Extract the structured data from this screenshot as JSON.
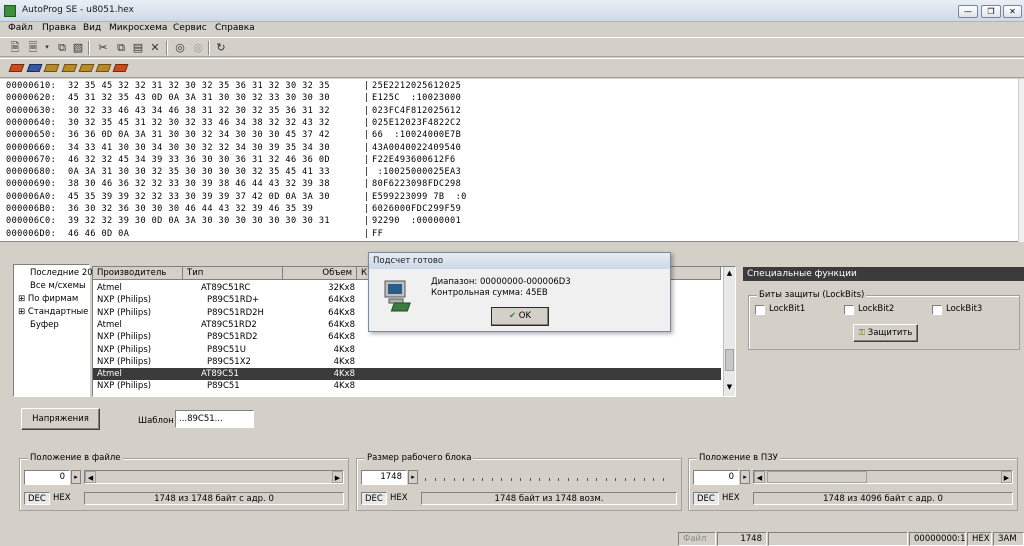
{
  "window": {
    "title": "AutoProg SE - u8051.hex",
    "buttons": [
      "minimize",
      "restore",
      "close"
    ]
  },
  "menubar": [
    "Файл",
    "Правка",
    "Вид",
    "Микросхема",
    "Сервис",
    "Справка"
  ],
  "toolbar1_icons": [
    "open-file-icon",
    "save-file-icon",
    "dropdown-arrow-icon",
    "copy-files-icon",
    "paste-files-icon",
    "cut-icon",
    "copy-icon",
    "paste-icon",
    "delete-icon",
    "find-icon",
    "find-next-icon",
    "refresh-icon"
  ],
  "toolbar2_icons": [
    "chip-read-icon",
    "chip-program-icon",
    "chip-verify-icon",
    "chip-erase-icon",
    "chip-blank-icon",
    "chip-auto-icon"
  ],
  "hex_rows": [
    {
      "addr": "00000610:",
      "bytes": "32 35 45 32 32 31 32 30 32 35 36 31 32 30 32 35",
      "ascii": "25E2212025612025"
    },
    {
      "addr": "00000620:",
      "bytes": "45 31 32 35 43 0D 0A 3A 31 30 30 32 33 30 30 30",
      "ascii": "E125C  :10023000"
    },
    {
      "addr": "00000630:",
      "bytes": "30 32 33 46 43 34 46 38 31 32 30 32 35 36 31 32",
      "ascii": "023FC4F812025612"
    },
    {
      "addr": "00000640:",
      "bytes": "30 32 35 45 31 32 30 32 33 46 34 38 32 32 43 32",
      "ascii": "025E12023F4822C2"
    },
    {
      "addr": "00000650:",
      "bytes": "36 36 0D 0A 3A 31 30 30 32 34 30 30 30 45 37 42",
      "ascii": "66  :10024000E7B"
    },
    {
      "addr": "00000660:",
      "bytes": "34 33 41 30 30 34 30 30 32 32 34 30 39 35 34 30",
      "ascii": "43A0040022409540"
    },
    {
      "addr": "00000670:",
      "bytes": "46 32 32 45 34 39 33 36 30 30 36 31 32 46 36 0D",
      "ascii": "F22E493600612F6"
    },
    {
      "addr": "00000680:",
      "bytes": "0A 3A 31 30 30 32 35 30 30 30 30 32 35 45 41 33",
      "ascii": " :10025000025EA3"
    },
    {
      "addr": "00000690:",
      "bytes": "38 30 46 36 32 32 33 30 39 38 46 44 43 32 39 38",
      "ascii": "80F6223098FDC298"
    },
    {
      "addr": "000006A0:",
      "bytes": "45 35 39 39 32 32 33 30 39 39 37 42 0D 0A 3A 30",
      "ascii": "E599223099 7B  :0"
    },
    {
      "addr": "000006B0:",
      "bytes": "36 30 32 36 30 30 30 46 44 43 32 39 46 35 39",
      "ascii": "6026000FDC299F59"
    },
    {
      "addr": "000006C0:",
      "bytes": "39 32 32 39 30 0D 0A 3A 30 30 30 30 30 30 30 31",
      "ascii": "92290  :00000001"
    },
    {
      "addr": "000006D0:",
      "bytes": "46 46 0D 0A",
      "ascii": "FF"
    }
  ],
  "tree": [
    "Последние 20",
    "Все м/схемы",
    "По фирмам",
    "Стандартные",
    "Буфер"
  ],
  "device_list": {
    "columns": [
      "Производитель",
      "Тип",
      "Объем",
      "К"
    ],
    "rows": [
      {
        "maker": "Atmel",
        "type": "AT89C51RC",
        "size": "32Kx8",
        "selected": false
      },
      {
        "maker": "NXP (Philips)",
        "type": "P89C51RD+",
        "size": "64Kx8",
        "selected": false
      },
      {
        "maker": "NXP (Philips)",
        "type": "P89C51RD2H",
        "size": "64Kx8",
        "selected": false
      },
      {
        "maker": "Atmel",
        "type": "AT89C51RD2",
        "size": "64Kx8",
        "selected": false
      },
      {
        "maker": "NXP (Philips)",
        "type": "P89C51RD2",
        "size": "64Kx8",
        "selected": false
      },
      {
        "maker": "NXP (Philips)",
        "type": "P89C51U",
        "size": "4Kx8",
        "selected": false
      },
      {
        "maker": "NXP (Philips)",
        "type": "P89C51X2",
        "size": "4Kx8",
        "selected": false
      },
      {
        "maker": "Atmel",
        "type": "AT89C51",
        "size": "4Kx8",
        "selected": true
      },
      {
        "maker": "NXP (Philips)",
        "type": "P89C51",
        "size": "4Kx8",
        "selected": false
      }
    ]
  },
  "voltages_button": "Напряжения",
  "template": {
    "label": "Шаблон",
    "value": "...89C51..."
  },
  "dialog": {
    "title": "Подсчет готово",
    "range_line": "Диапазон: 00000000-000006D3",
    "checksum_line": "Контрольная сумма: 45EB",
    "ok_label": "OK"
  },
  "special": {
    "header": "Специальные функции",
    "group_title": "Биты защиты (LockBits)",
    "lockbits": [
      "LockBit1",
      "LockBit2",
      "LockBit3"
    ],
    "protect_button": "Защитить"
  },
  "panels": [
    {
      "title": "Положение в файле",
      "value": "0",
      "dec": "DEC",
      "hex": "HEX",
      "info": "1748 из 1748 байт с адр. 0"
    },
    {
      "title": "Размер рабочего блока",
      "value": "1748",
      "dec": "DEC",
      "hex": "HEX",
      "info": "1748 байт из 1748 возм."
    },
    {
      "title": "Положение в ПЗУ",
      "value": "0",
      "dec": "DEC",
      "hex": "HEX",
      "info": "1748 из 4096 байт с адр. 0"
    }
  ],
  "statusbar": {
    "file_label": "Файл",
    "size": "1748",
    "address": "00000000:1",
    "mode": "HEX",
    "ins": "ЗАМ"
  }
}
